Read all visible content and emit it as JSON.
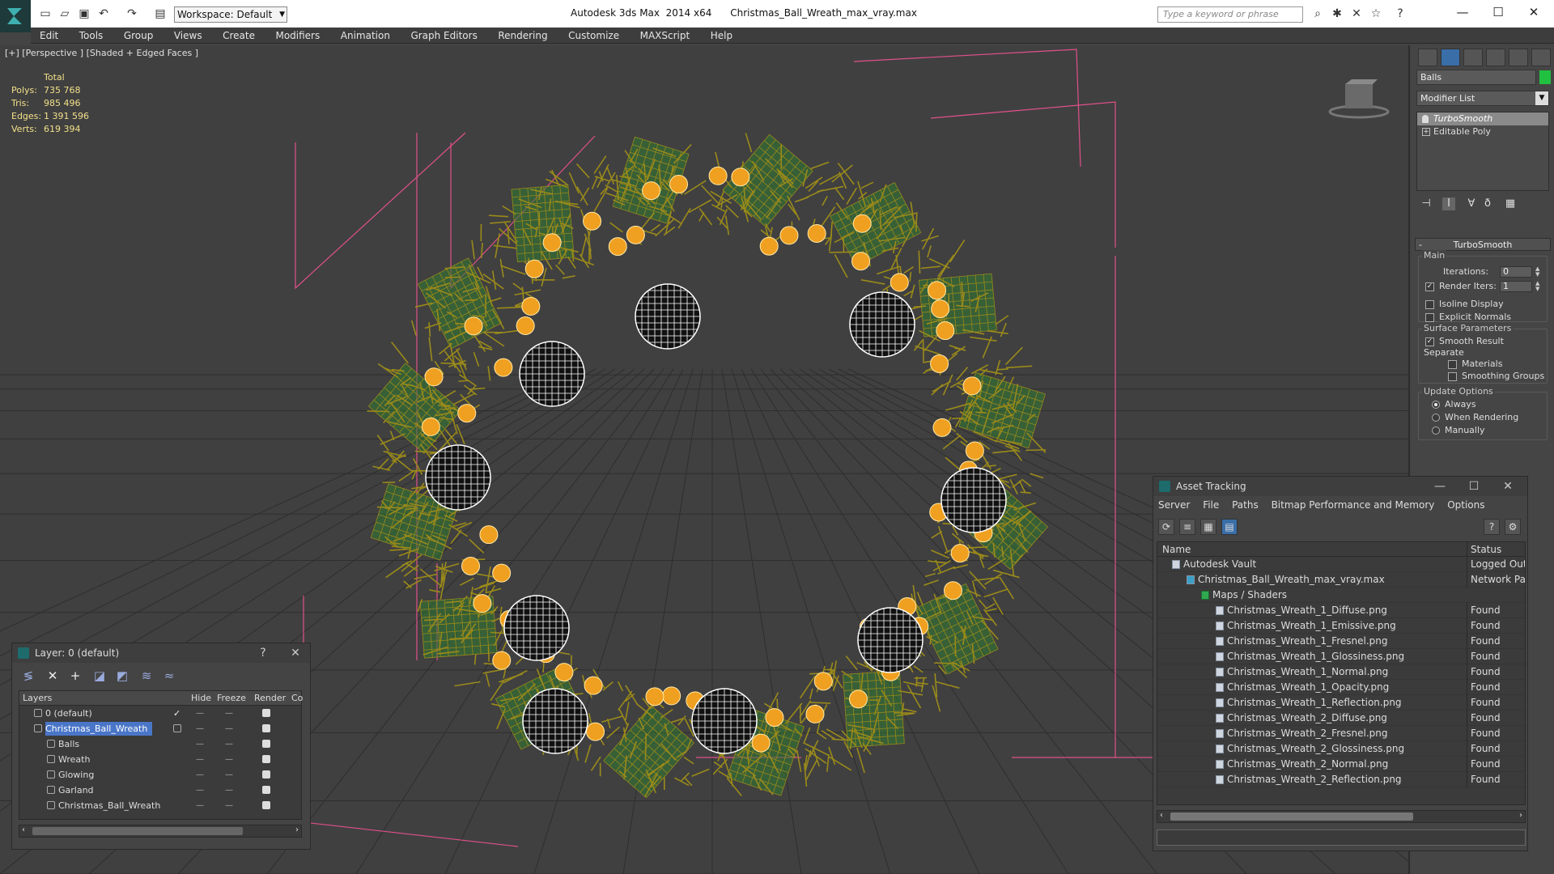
{
  "titlebar": {
    "workspace": "Workspace: Default",
    "title": "Autodesk 3ds Max  2014 x64      Christmas_Ball_Wreath_max_vray.max",
    "search_placeholder": "Type a keyword or phrase"
  },
  "menu": [
    "Edit",
    "Tools",
    "Group",
    "Views",
    "Create",
    "Modifiers",
    "Animation",
    "Graph Editors",
    "Rendering",
    "Customize",
    "MAXScript",
    "Help"
  ],
  "viewport": {
    "label": "[+] [Perspective ] [Shaded + Edged Faces ]",
    "stats_header": "Total",
    "stats": [
      {
        "label": "Polys:",
        "value": "735 768"
      },
      {
        "label": "Tris:",
        "value": "985 496"
      },
      {
        "label": "Edges:",
        "value": "1 391 596"
      },
      {
        "label": "Verts:",
        "value": "619 394"
      }
    ],
    "colors": {
      "wreath": "#9a8a1a",
      "leaf": "#2f7a2f",
      "bbox": "#e0508a",
      "grid": "#2e2e2e",
      "ornament_glow": "#f0a020"
    }
  },
  "command_panel": {
    "object_name": "Balls",
    "object_color": "#22c040",
    "modifier_list": "Modifier List",
    "stack": [
      {
        "label": "TurboSmooth",
        "active": true
      },
      {
        "label": "Editable Poly",
        "active": false
      }
    ],
    "rollout_title": "TurboSmooth",
    "main_group": "Main",
    "iterations_label": "Iterations:",
    "iterations_value": "0",
    "render_iters_label": "Render Iters:",
    "render_iters_value": "1",
    "isoline": "Isoline Display",
    "explicit_normals": "Explicit Normals",
    "surface_group": "Surface Parameters",
    "smooth_result": "Smooth Result",
    "separate": "Separate",
    "materials": "Materials",
    "smoothing_groups": "Smoothing Groups",
    "update_group": "Update Options",
    "always": "Always",
    "when_rendering": "When Rendering",
    "manually": "Manually"
  },
  "layer_window": {
    "title": "Layer: 0 (default)",
    "help": "?",
    "columns": [
      "Layers",
      "Hide",
      "Freeze",
      "Render",
      "Co"
    ],
    "rows": [
      {
        "name": "0 (default)",
        "indent": 1,
        "selected": false,
        "checked": true
      },
      {
        "name": "Christmas_Ball_Wreath",
        "indent": 1,
        "selected": true,
        "checked": false
      },
      {
        "name": "Balls",
        "indent": 2,
        "selected": false,
        "checked": false
      },
      {
        "name": "Wreath",
        "indent": 2,
        "selected": false,
        "checked": false
      },
      {
        "name": "Glowing",
        "indent": 2,
        "selected": false,
        "checked": false
      },
      {
        "name": "Garland",
        "indent": 2,
        "selected": false,
        "checked": false
      },
      {
        "name": "Christmas_Ball_Wreath",
        "indent": 2,
        "selected": false,
        "checked": false
      }
    ],
    "dash": "—"
  },
  "asset_window": {
    "title": "Asset Tracking",
    "menu": [
      "Server",
      "File",
      "Paths",
      "Bitmap Performance and Memory",
      "Options"
    ],
    "columns": [
      "Name",
      "Status"
    ],
    "rows": [
      {
        "name": "Autodesk Vault",
        "status": "Logged Out ..",
        "indent": 1
      },
      {
        "name": "Christmas_Ball_Wreath_max_vray.max",
        "status": "Network Path",
        "indent": 2
      },
      {
        "name": "Maps / Shaders",
        "status": "",
        "indent": 3
      },
      {
        "name": "Christmas_Wreath_1_Diffuse.png",
        "status": "Found",
        "indent": 4
      },
      {
        "name": "Christmas_Wreath_1_Emissive.png",
        "status": "Found",
        "indent": 4
      },
      {
        "name": "Christmas_Wreath_1_Fresnel.png",
        "status": "Found",
        "indent": 4
      },
      {
        "name": "Christmas_Wreath_1_Glossiness.png",
        "status": "Found",
        "indent": 4
      },
      {
        "name": "Christmas_Wreath_1_Normal.png",
        "status": "Found",
        "indent": 4
      },
      {
        "name": "Christmas_Wreath_1_Opacity.png",
        "status": "Found",
        "indent": 4
      },
      {
        "name": "Christmas_Wreath_1_Reflection.png",
        "status": "Found",
        "indent": 4
      },
      {
        "name": "Christmas_Wreath_2_Diffuse.png",
        "status": "Found",
        "indent": 4
      },
      {
        "name": "Christmas_Wreath_2_Fresnel.png",
        "status": "Found",
        "indent": 4
      },
      {
        "name": "Christmas_Wreath_2_Glossiness.png",
        "status": "Found",
        "indent": 4
      },
      {
        "name": "Christmas_Wreath_2_Normal.png",
        "status": "Found",
        "indent": 4
      },
      {
        "name": "Christmas_Wreath_2_Reflection.png",
        "status": "Found",
        "indent": 4
      }
    ]
  }
}
